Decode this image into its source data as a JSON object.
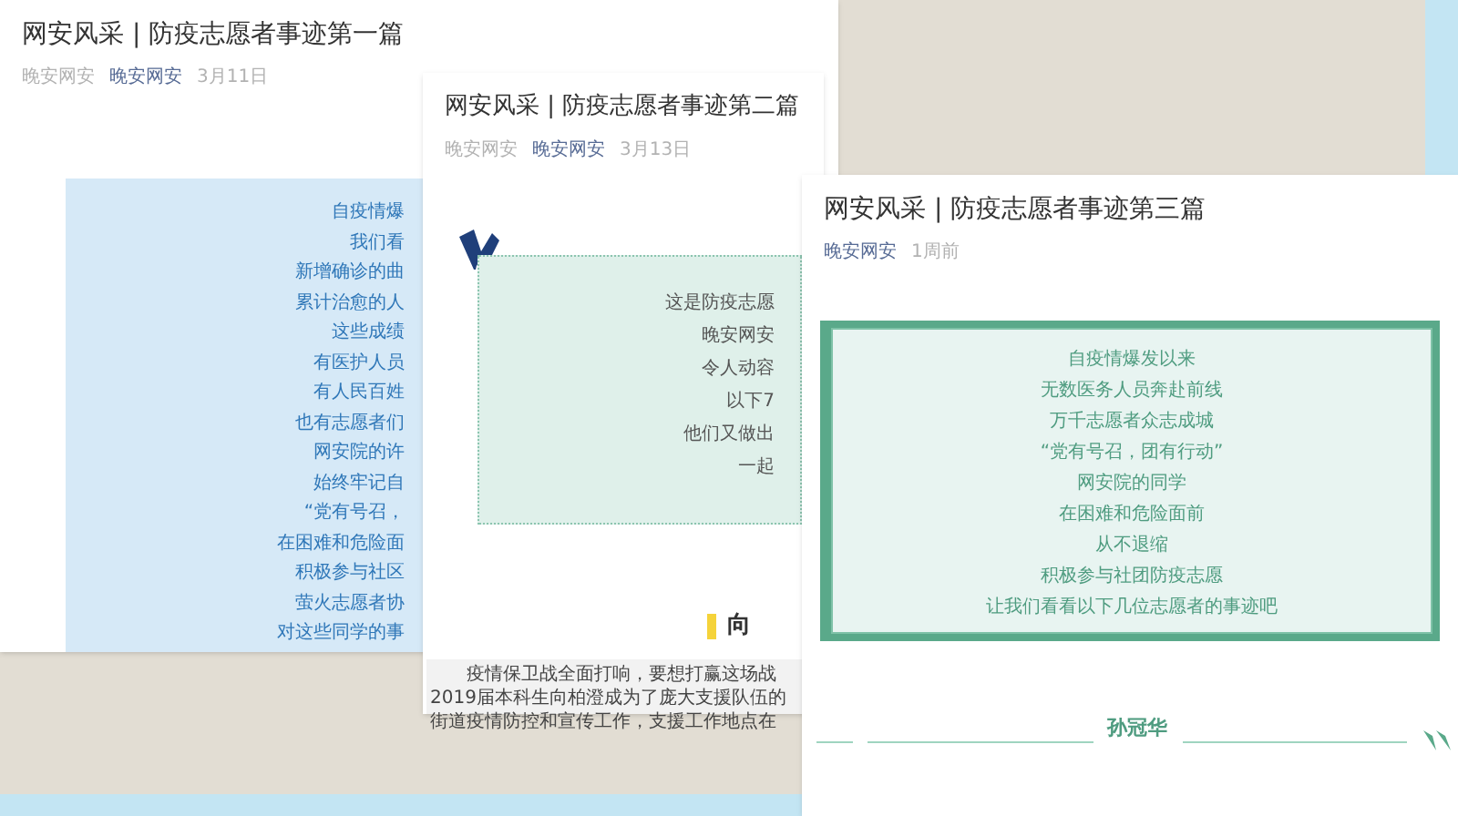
{
  "cards": [
    {
      "kind": "blue-paper",
      "title": "网安风采 | 防疫志愿者事迹第一篇",
      "meta": [
        {
          "kind": "author",
          "text": "晚安网安"
        },
        {
          "kind": "account",
          "text": "晚安网安"
        },
        {
          "kind": "time",
          "text": "3月11日"
        }
      ],
      "intro_lines": [
        "自疫情爆",
        "我们看",
        "新增确诊的曲",
        "累计治愈的人",
        "这些成绩",
        "有医护人员",
        "有人民百姓",
        "也有志愿者们",
        "网安院的许",
        "始终牢记自",
        "“党有号召，",
        "在困难和危险面",
        "积极参与社区",
        "萤火志愿者协",
        "对这些同学的事"
      ]
    },
    {
      "kind": "mint-dotted",
      "title": "网安风采 | 防疫志愿者事迹第二篇",
      "meta": [
        {
          "kind": "author",
          "text": "晚安网安"
        },
        {
          "kind": "account",
          "text": "晚安网安"
        },
        {
          "kind": "time",
          "text": "3月13日"
        }
      ],
      "intro_lines": [
        "这是防疫志愿",
        "晚安网安",
        "令人动容",
        "以下7",
        "他们又做出",
        "一起"
      ],
      "section_heading": "向",
      "paragraph_lines": [
        "疫情保卫战全面打响，要想打赢这场战",
        "2019届本科生向柏澄成为了庞大支援队伍的",
        "街道疫情防控和宣传工作，支援工作地点在"
      ]
    },
    {
      "kind": "green-frame",
      "title": "网安风采 | 防疫志愿者事迹第三篇",
      "meta": [
        {
          "kind": "account",
          "text": "晚安网安"
        },
        {
          "kind": "time",
          "text": "1周前"
        }
      ],
      "intro_lines": [
        "自疫情爆发以来",
        "无数医务人员奔赴前线",
        "万千志愿者众志成城",
        "“党有号召，团有行动”",
        "网安院的同学",
        "在困难和危险面前",
        "从不退缩",
        "积极参与社团防疫志愿",
        "让我们看看以下几位志愿者的事迹吧"
      ],
      "section_heading": "孙冠华"
    }
  ]
}
